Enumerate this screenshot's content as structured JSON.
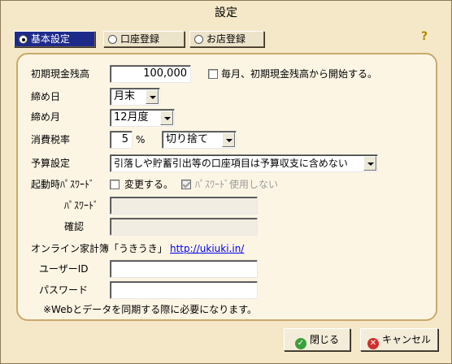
{
  "window": {
    "title": "設定"
  },
  "tabs": [
    {
      "label": "基本設定",
      "selected": true
    },
    {
      "label": "口座登録",
      "selected": false
    },
    {
      "label": "お店登録",
      "selected": false
    }
  ],
  "help": {
    "icon": "help-question-icon",
    "glyph": "?"
  },
  "form": {
    "initial_balance": {
      "label": "初期現金残高",
      "value": "100,000"
    },
    "monthly_reset": {
      "label": "毎月、初期現金残高から開始する。",
      "checked": false
    },
    "closing_day": {
      "label": "締め日",
      "value": "月末"
    },
    "closing_month": {
      "label": "締め月",
      "value": "12月度"
    },
    "tax": {
      "label": "消費税率",
      "value": "5",
      "unit": "%",
      "rounding": "切り捨て"
    },
    "budget": {
      "label": "予算設定",
      "value": "引落しや貯蓄引出等の口座項目は予算収支に含めない"
    },
    "startup_password": {
      "label": "起動時ﾊﾟｽﾜｰﾄﾞ",
      "change_label": "変更する。",
      "change_checked": false,
      "no_password_label": "ﾊﾟｽﾜｰﾄﾞ使用しない",
      "no_password_checked": true
    },
    "password": {
      "label": "ﾊﾟｽﾜｰﾄﾞ",
      "value": ""
    },
    "confirm": {
      "label": "確認",
      "value": ""
    },
    "online": {
      "label": "オンライン家計簿「うきうき」",
      "link": "http://ukiuki.in/",
      "user_id_label": "ユーザーID",
      "user_id_value": "",
      "password_label": "パスワード",
      "password_value": "",
      "note": "※Webとデータを同期する際に必要になります。"
    }
  },
  "buttons": {
    "close": {
      "label": "閉じる",
      "icon": "check-icon",
      "color": "#3aa03a"
    },
    "cancel": {
      "label": "キャンセル",
      "icon": "cancel-icon",
      "color": "#d03030"
    }
  },
  "colors": {
    "window_bg": "#f5e8c8",
    "panel_bg": "#fdf5e4",
    "panel_border": "#c9a96c",
    "active_tab": "#1e2a8a"
  }
}
